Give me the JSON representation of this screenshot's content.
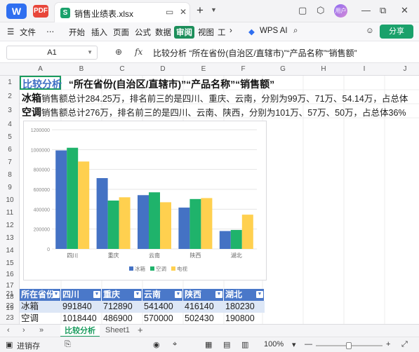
{
  "app": {
    "logo": "W",
    "pdf_icon": "PDF"
  },
  "tab": {
    "icon": "S",
    "filename": "销售业绩表.xlsx"
  },
  "window": {
    "avatar": "用户"
  },
  "menu": {
    "file": "文件",
    "more": "⋯",
    "start": "开始",
    "insert": "插入",
    "page": "页面",
    "formula": "公式",
    "data": "数据",
    "review": "审阅",
    "view": "视图",
    "tools": "工",
    "next": "›",
    "wps_ai": "WPS AI",
    "share": "分享"
  },
  "formula_bar": {
    "cell_ref": "A1",
    "fx_label": "fx",
    "content": "比较分析  “所在省份(自治区/直辖市)”“产品名称”“销售额”"
  },
  "columns": [
    "A",
    "B",
    "C",
    "D",
    "E",
    "F",
    "G",
    "H",
    "I",
    "J"
  ],
  "rows": [
    "1",
    "2",
    "3",
    "4",
    "5",
    "6",
    "7",
    "8",
    "9",
    "10",
    "11",
    "12",
    "13",
    "14",
    "15",
    "16",
    "17",
    "18",
    "19",
    "20",
    "21",
    "22",
    "23"
  ],
  "sheet": {
    "title_blue": "比较分析",
    "title_rest": "“所在省份(自治区/直辖市)”“产品名称”“销售额”",
    "row2_bold": "冰箱",
    "row2_text": "销售额总计284.25万，排名前三的是四川、重庆、云南，分别为99万、71万、54.14万，占总体",
    "row3_bold": "空调",
    "row3_text": "销售额总计276万，排名前三的是四川、云南、陕西，分别为101万、57万、50万，占总体36%"
  },
  "chart_data": {
    "type": "bar",
    "categories": [
      "四川",
      "重庆",
      "云南",
      "陕西",
      "湖北"
    ],
    "series": [
      {
        "name": "冰箱",
        "color": "#4472c4",
        "values": [
          991840,
          712890,
          541400,
          416140,
          180230
        ]
      },
      {
        "name": "空调",
        "color": "#1fb36b",
        "values": [
          1018440,
          486900,
          570000,
          502430,
          190800
        ]
      },
      {
        "name": "电视",
        "color": "#ffd04f",
        "values": [
          880000,
          520000,
          470000,
          512000,
          345000
        ]
      }
    ],
    "y_ticks": [
      "1200000",
      "1000000",
      "800000",
      "600000",
      "400000",
      "200000",
      "0"
    ],
    "ylim": [
      0,
      1200000
    ],
    "grid": true,
    "legend": "bottom"
  },
  "table": {
    "headers": [
      "所在省份",
      "四川",
      "重庆",
      "云南",
      "陕西",
      "湖北"
    ],
    "rows": [
      [
        "冰箱",
        "991840",
        "712890",
        "541400",
        "416140",
        "180230"
      ],
      [
        "空调",
        "1018440",
        "486900",
        "570000",
        "502430",
        "190800"
      ]
    ]
  },
  "sheet_tabs": {
    "nav": "‹ ›",
    "active": "比较分析",
    "other": "Sheet1",
    "add": "+"
  },
  "status": {
    "mode": "进销存",
    "zoom": "100%",
    "minus": "—",
    "plus": "+"
  }
}
